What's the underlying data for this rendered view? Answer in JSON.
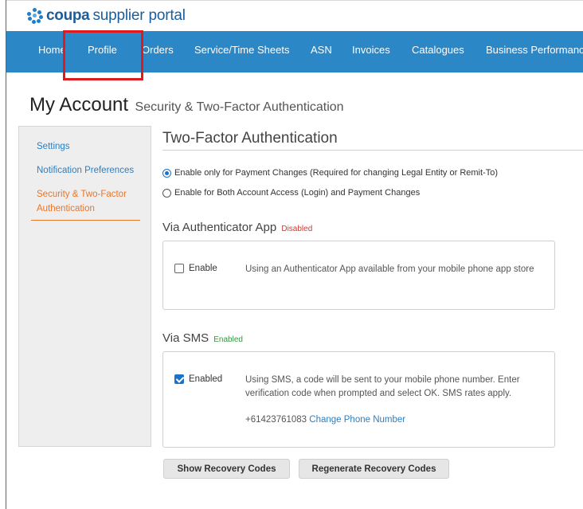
{
  "brand": {
    "name": "coupa",
    "suffix": "supplier portal"
  },
  "nav": [
    {
      "label": "Home"
    },
    {
      "label": "Profile"
    },
    {
      "label": "Orders"
    },
    {
      "label": "Service/Time Sheets"
    },
    {
      "label": "ASN"
    },
    {
      "label": "Invoices"
    },
    {
      "label": "Catalogues"
    },
    {
      "label": "Business Performance"
    }
  ],
  "page": {
    "title": "My Account",
    "subtitle": "Security & Two-Factor Authentication"
  },
  "sidebar": {
    "items": [
      {
        "label": "Settings"
      },
      {
        "label": "Notification Preferences"
      },
      {
        "label": "Security & Two-Factor Authentication"
      }
    ]
  },
  "tfa": {
    "title": "Two-Factor Authentication",
    "options": [
      {
        "label": "Enable only for Payment Changes (Required for changing Legal Entity or Remit-To)",
        "checked": true
      },
      {
        "label": "Enable for Both Account Access (Login) and Payment Changes",
        "checked": false
      }
    ]
  },
  "app": {
    "heading": "Via Authenticator App",
    "status": "Disabled",
    "checkbox_label": "Enable",
    "checked": false,
    "description": "Using an Authenticator App available from your mobile phone app store"
  },
  "sms": {
    "heading": "Via SMS",
    "status": "Enabled",
    "checkbox_label": "Enabled",
    "checked": true,
    "description": "Using SMS, a code will be sent to your mobile phone number. Enter verification code when prompted and select OK. SMS rates apply.",
    "phone": "+61423761083",
    "change_link": "Change Phone Number"
  },
  "buttons": {
    "show_recovery": "Show Recovery Codes",
    "regenerate_recovery": "Regenerate Recovery Codes"
  },
  "colors": {
    "nav_bg": "#2c87c7",
    "accent_orange": "#e8762a",
    "link_blue": "#2b7fc2",
    "highlight_red": "#e0191c",
    "disabled_red": "#d9342b",
    "enabled_green": "#2e9a3a"
  }
}
